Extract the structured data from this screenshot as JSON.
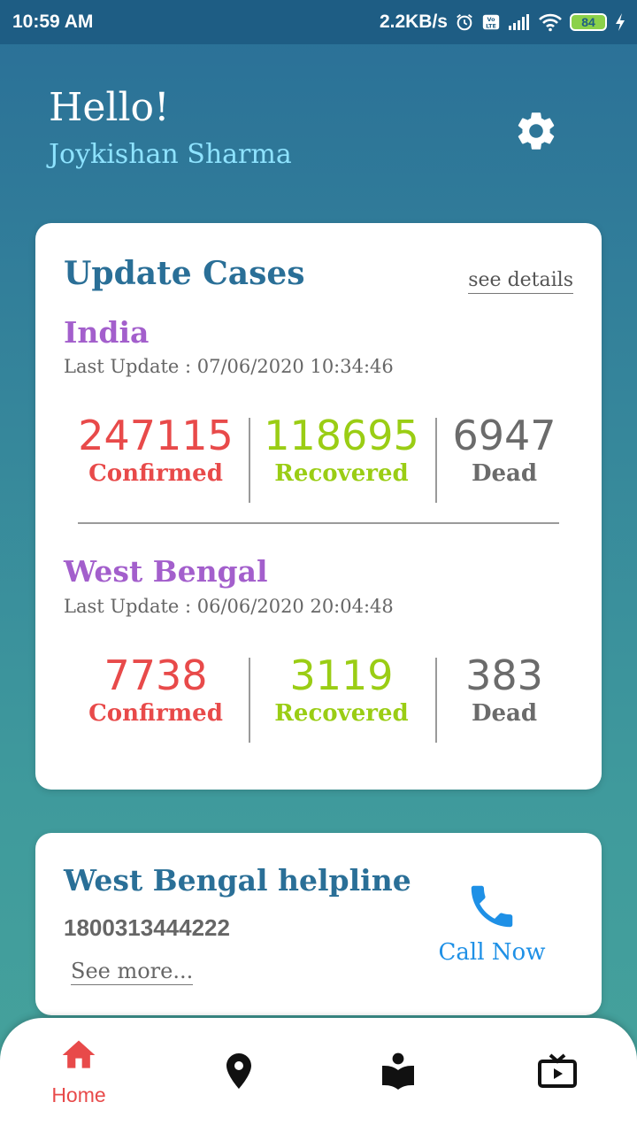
{
  "status_bar": {
    "time": "10:59 AM",
    "net_speed": "2.2KB/s",
    "battery_level": "84",
    "icons": [
      "alarm-icon",
      "volte-icon",
      "signal-icon",
      "wifi-icon",
      "battery-icon",
      "charging-icon"
    ]
  },
  "header": {
    "greeting": "Hello!",
    "user_name": "Joykishan Sharma",
    "settings_icon": "gear-icon"
  },
  "cases_card": {
    "title": "Update Cases",
    "see_details": "see details",
    "regions": [
      {
        "name": "India",
        "last_update": "Last Update : 07/06/2020 10:34:46",
        "confirmed": "247115",
        "recovered": "118695",
        "dead": "6947"
      },
      {
        "name": "West Bengal",
        "last_update": "Last Update : 06/06/2020 20:04:48",
        "confirmed": "7738",
        "recovered": "3119",
        "dead": "383"
      }
    ],
    "labels": {
      "confirmed": "Confirmed",
      "recovered": "Recovered",
      "dead": "Dead"
    }
  },
  "helpline_card": {
    "title": "West Bengal helpline",
    "number": "1800313444222",
    "see_more": "See more...",
    "call_label": "Call Now"
  },
  "bottom_nav": {
    "items": [
      {
        "label": "Home",
        "icon": "home-icon",
        "active": true
      },
      {
        "label": "",
        "icon": "location-pin-icon",
        "active": false
      },
      {
        "label": "",
        "icon": "reader-book-icon",
        "active": false
      },
      {
        "label": "",
        "icon": "tv-play-icon",
        "active": false
      }
    ]
  },
  "colors": {
    "confirmed": "#e84a4a",
    "recovered": "#9acd14",
    "dead": "#6b6b6b",
    "region_title": "#a35fcc",
    "card_title": "#2a6f97",
    "call": "#1e90e6"
  }
}
